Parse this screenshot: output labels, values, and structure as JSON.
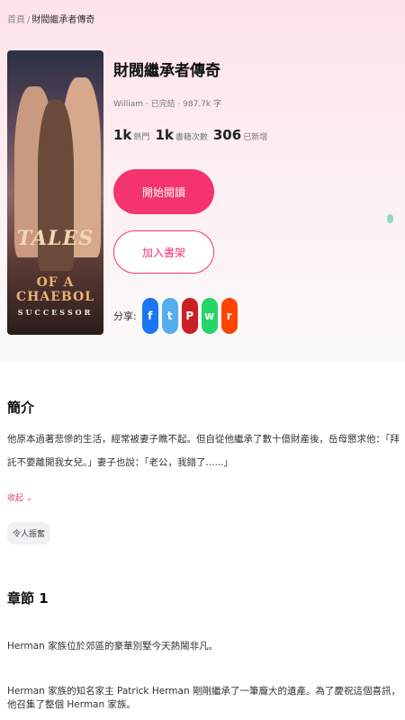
{
  "breadcrumb": {
    "home": "首頁",
    "separator": "/",
    "current": "財閥繼承者傳奇"
  },
  "book": {
    "title": "財閥繼承者傳奇",
    "meta": "William · 已完結 · 987.7k 字",
    "stats": [
      {
        "value": "1k",
        "label": "熱門"
      },
      {
        "value": "1k",
        "label": "書籍次數"
      },
      {
        "value": "306",
        "label": "已新增"
      }
    ],
    "cover": {
      "line1": "TALES",
      "line2": "OF A CHAEBOL",
      "line3": "SUCCESSOR"
    }
  },
  "actions": {
    "read_label": "開始閱讀",
    "shelf_label": "加入書架"
  },
  "share": {
    "label": "分享:",
    "icons": [
      {
        "name": "facebook-icon",
        "glyph": "f",
        "color": "#1877f2"
      },
      {
        "name": "twitter-icon",
        "glyph": "t",
        "color": "#55acee"
      },
      {
        "name": "pinterest-icon",
        "glyph": "P",
        "color": "#cb2027"
      },
      {
        "name": "whatsapp-icon",
        "glyph": "w",
        "color": "#25d366"
      },
      {
        "name": "reddit-icon",
        "glyph": "r",
        "color": "#ff4500"
      }
    ]
  },
  "intro": {
    "heading": "簡介",
    "text": "他原本過著悲慘的生活，經常被妻子瞧不起。但自從他繼承了數十億財產後，岳母懇求他：「拜託不要離開我女兒。」妻子也說：「老公，我錯了......」",
    "collapse_label": "收起 ⌄",
    "tag": "令人振奮"
  },
  "chapter": {
    "heading": "章節 1",
    "paragraphs": [
      "Herman 家族位於郊區的豪華別墅今天熱鬧非凡。",
      "Herman 家族的知名家主 Patrick Herman 剛剛繼承了一筆龐大的遺產。為了慶祝這個喜訊，他召集了整個 Herman 家族。"
    ]
  },
  "colors": {
    "accent": "#f4346e",
    "hero_bg": "#fde3ea"
  }
}
